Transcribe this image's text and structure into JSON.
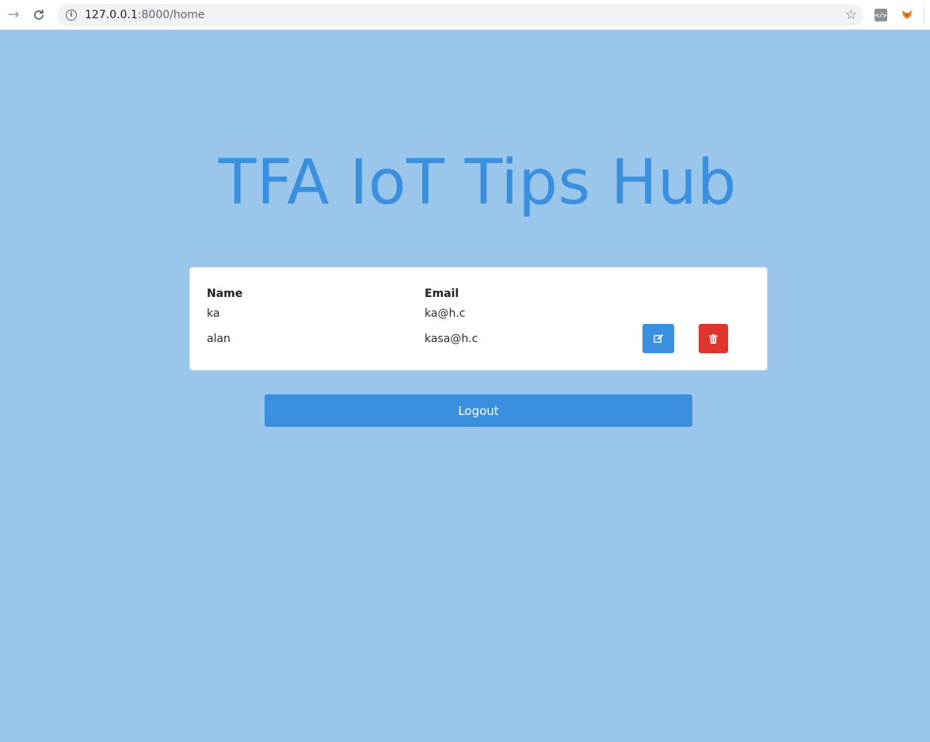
{
  "browser": {
    "url_host": "127.0.0.1",
    "url_path": ":8000/home",
    "forward_icon": "arrow-right-icon",
    "reload_icon": "reload-icon",
    "info_icon": "info-icon",
    "bookmark_icon": "star-icon",
    "extensions": [
      "code-view-icon",
      "fox-extension-icon"
    ]
  },
  "page": {
    "title": "TFA IoT Tips Hub",
    "background_color": "#9bc6ec",
    "accent_color": "#3a8fde",
    "danger_color": "#e0342f"
  },
  "users_table": {
    "headers": {
      "name": "Name",
      "email": "Email"
    },
    "rows": [
      {
        "name": "ka",
        "email": "ka@h.c"
      },
      {
        "name": "alan",
        "email": "kasa@h.c"
      }
    ],
    "edit_icon": "edit-icon",
    "delete_icon": "trash-icon"
  },
  "actions": {
    "logout_label": "Logout"
  }
}
